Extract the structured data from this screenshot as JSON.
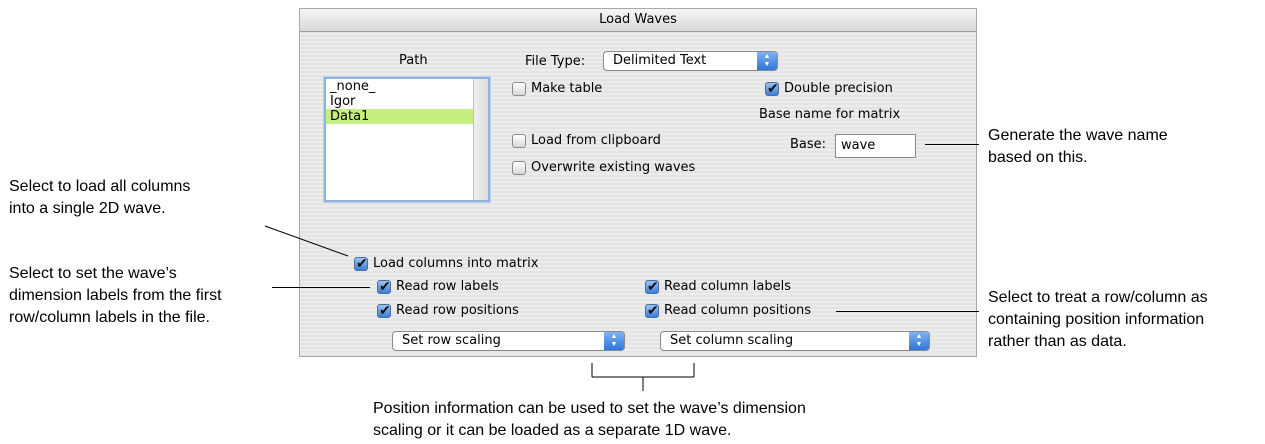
{
  "dialog": {
    "title": "Load Waves",
    "path_label": "Path",
    "path_items": [
      "_none_",
      "Igor",
      "Data1"
    ],
    "path_selected": "Data1",
    "file_type_label": "File Type:",
    "file_type_value": "Delimited Text",
    "make_table": {
      "label": "Make table",
      "checked": false
    },
    "double_precision": {
      "label": "Double precision",
      "checked": true
    },
    "base_name_heading": "Base name for matrix",
    "base_label": "Base:",
    "base_value": "wave",
    "load_from_clipboard": {
      "label": "Load from clipboard",
      "checked": false
    },
    "overwrite_existing": {
      "label": "Overwrite existing waves",
      "checked": false
    },
    "load_columns_into_matrix": {
      "label": "Load columns into matrix",
      "checked": true
    },
    "read_row_labels": {
      "label": "Read row labels",
      "checked": true
    },
    "read_row_positions": {
      "label": "Read row positions",
      "checked": true
    },
    "read_column_labels": {
      "label": "Read column labels",
      "checked": true
    },
    "read_column_positions": {
      "label": "Read column positions",
      "checked": true
    },
    "set_row_scaling": "Set row scaling",
    "set_column_scaling": "Set column scaling"
  },
  "annotations": {
    "generate_name": [
      "Generate the wave name",
      "based on this."
    ],
    "load_all_columns": [
      "Select to load all columns",
      "into a single 2D wave."
    ],
    "dimension_labels": [
      "Select to set the wave’s",
      "dimension labels from the first",
      "row/column labels in the file."
    ],
    "position_info": [
      "Select to treat a row/column as",
      "containing position information",
      "rather than as data."
    ],
    "scaling": [
      "Position information can be used to set the wave’s dimension",
      "scaling or it can be loaded as a separate 1D wave."
    ]
  }
}
